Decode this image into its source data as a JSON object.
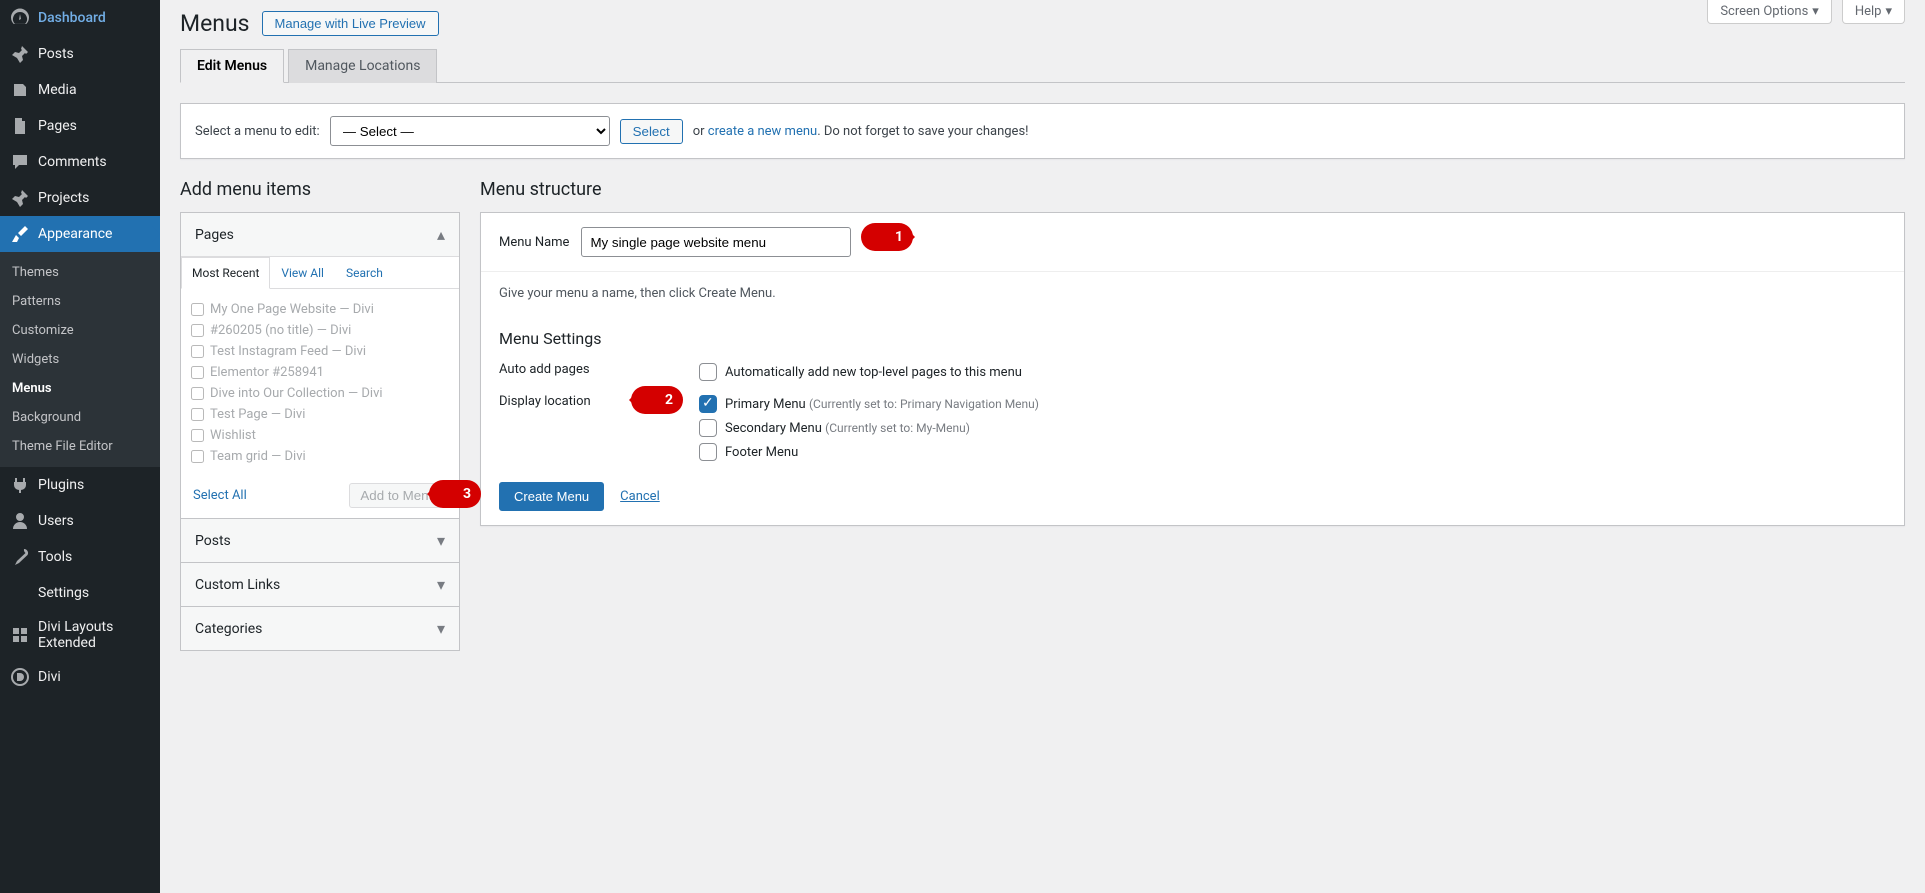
{
  "top_buttons": {
    "screen_options": "Screen Options",
    "help": "Help"
  },
  "sidebar": {
    "items": [
      {
        "label": "Dashboard"
      },
      {
        "label": "Posts"
      },
      {
        "label": "Media"
      },
      {
        "label": "Pages"
      },
      {
        "label": "Comments"
      },
      {
        "label": "Projects"
      },
      {
        "label": "Appearance"
      },
      {
        "label": "Plugins"
      },
      {
        "label": "Users"
      },
      {
        "label": "Tools"
      },
      {
        "label": "Settings"
      },
      {
        "label": "Divi Layouts Extended"
      },
      {
        "label": "Divi"
      }
    ],
    "submenu": {
      "items": [
        {
          "label": "Themes"
        },
        {
          "label": "Patterns"
        },
        {
          "label": "Customize"
        },
        {
          "label": "Widgets"
        },
        {
          "label": "Menus"
        },
        {
          "label": "Background"
        },
        {
          "label": "Theme File Editor"
        }
      ]
    }
  },
  "page_title": "Menus",
  "preview_button": "Manage with Live Preview",
  "tabs": {
    "edit": "Edit Menus",
    "locations": "Manage Locations"
  },
  "select_row": {
    "label": "Select a menu to edit:",
    "placeholder": "— Select —",
    "select_btn": "Select",
    "or_text": "or ",
    "create_link": "create a new menu",
    "reminder": ". Do not forget to save your changes!"
  },
  "left": {
    "heading": "Add menu items",
    "accordion": {
      "pages": "Pages",
      "posts": "Posts",
      "custom": "Custom Links",
      "categories": "Categories"
    },
    "inner_tabs": {
      "recent": "Most Recent",
      "viewall": "View All",
      "search": "Search"
    },
    "page_items": [
      "My One Page Website — Divi",
      "#260205 (no title) — Divi",
      "Test Instagram Feed — Divi",
      "Elementor #258941",
      "Dive into Our Collection — Divi",
      "Test Page — Divi",
      "Wishlist",
      "Team grid — Divi"
    ],
    "select_all": "Select All",
    "add_to_menu": "Add to Menu"
  },
  "right": {
    "heading": "Menu structure",
    "menu_name_label": "Menu Name",
    "menu_name_value": "My single page website menu",
    "hint": "Give your menu a name, then click Create Menu.",
    "settings_heading": "Menu Settings",
    "auto_add_label": "Auto add pages",
    "auto_add_opt": "Automatically add new top-level pages to this menu",
    "display_loc_label": "Display location",
    "loc_primary": "Primary Menu ",
    "loc_primary_sub": "(Currently set to: Primary Navigation Menu)",
    "loc_secondary": "Secondary Menu ",
    "loc_secondary_sub": "(Currently set to: My-Menu)",
    "loc_footer": "Footer Menu",
    "create_btn": "Create Menu",
    "cancel": "Cancel"
  },
  "annotations": {
    "b1": "1",
    "b2": "2",
    "b3": "3"
  }
}
